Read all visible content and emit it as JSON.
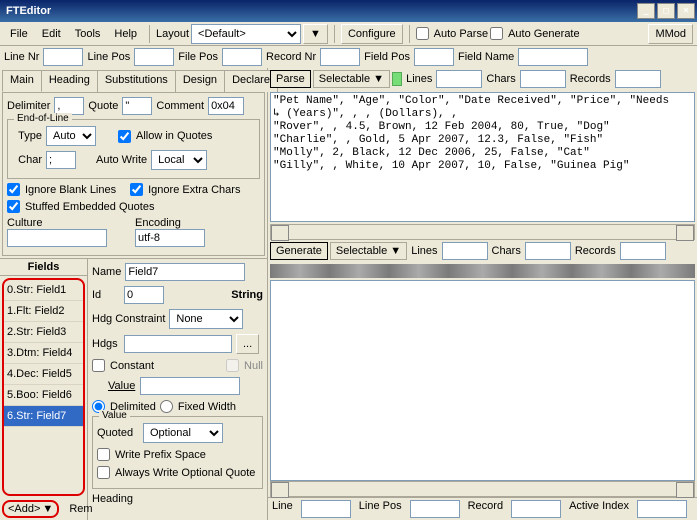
{
  "window": {
    "title": "FTEditor"
  },
  "menu": {
    "file": "File",
    "edit": "Edit",
    "tools": "Tools",
    "help": "Help",
    "layout": "Layout",
    "layout_sel": "<Default>",
    "configure": "Configure",
    "autoparse": "Auto Parse",
    "autogen": "Auto Generate",
    "mmod": "MMod"
  },
  "tb2": {
    "linenr": "Line Nr",
    "linepos": "Line Pos",
    "filepos": "File Pos",
    "recordnr": "Record Nr",
    "fieldpos": "Field Pos",
    "fieldname": "Field Name"
  },
  "tabs": {
    "main": "Main",
    "heading": "Heading",
    "subs": "Substitutions",
    "design": "Design",
    "declare": "Declare"
  },
  "maintab": {
    "delimiter": "Delimiter",
    "delimiter_v": ",",
    "quote": "Quote",
    "quote_v": "\"",
    "comment": "Comment",
    "comment_v": "0x04",
    "eol": "End-of-Line",
    "type": "Type",
    "type_v": "Auto",
    "allowq": "Allow in Quotes",
    "char": "Char",
    "char_v": ";",
    "autowrite": "Auto Write",
    "autowrite_v": "Local",
    "ignoreblank": "Ignore Blank Lines",
    "ignoreextra": "Ignore Extra Chars",
    "stuffed": "Stuffed Embedded Quotes",
    "culture": "Culture",
    "encoding": "Encoding",
    "encoding_v": "utf-8"
  },
  "fields": {
    "hdr": "Fields",
    "items": [
      "0.Str: Field1",
      "1.Flt: Field2",
      "2.Str: Field3",
      "3.Dtm: Field4",
      "4.Dec: Field5",
      "5.Boo: Field6",
      "6.Str: Field7"
    ],
    "add": "<Add>",
    "rem": "Rem"
  },
  "fd": {
    "name": "Name",
    "name_v": "Field7",
    "id": "Id",
    "id_v": "0",
    "type": "String",
    "hdgc": "Hdg Constraint",
    "hdgc_v": "None",
    "hdgs": "Hdgs",
    "hdgs_btn": "...",
    "constant": "Constant",
    "null": "Null",
    "value": "Value",
    "delimited": "Delimited",
    "fixed": "Fixed Width",
    "value2": "Value",
    "quoted": "Quoted",
    "quoted_v": "Optional",
    "wps": "Write Prefix Space",
    "awoq": "Always Write Optional Quote",
    "heading": "Heading"
  },
  "parse": {
    "parse": "Parse",
    "selectable": "Selectable",
    "lines": "Lines",
    "chars": "Chars",
    "records": "Records",
    "text": "\"Pet Name\", \"Age\", \"Color\", \"Date Received\", \"Price\", \"Needs\n↳ (Years)\", , , (Dollars), ,\n\"Rover\", , 4.5, Brown, 12 Feb 2004, 80, True, \"Dog\"\n\"Charlie\", , Gold, 5 Apr 2007, 12.3, False, \"Fish\"\n\"Molly\", 2, Black, 12 Dec 2006, 25, False, \"Cat\"\n\"Gilly\", , White, 10 Apr 2007, 10, False, \"Guinea Pig\""
  },
  "gen": {
    "generate": "Generate",
    "selectable": "Selectable",
    "lines": "Lines",
    "chars": "Chars",
    "records": "Records"
  },
  "status": {
    "line": "Line",
    "linepos": "Line Pos",
    "record": "Record",
    "active": "Active Index"
  }
}
